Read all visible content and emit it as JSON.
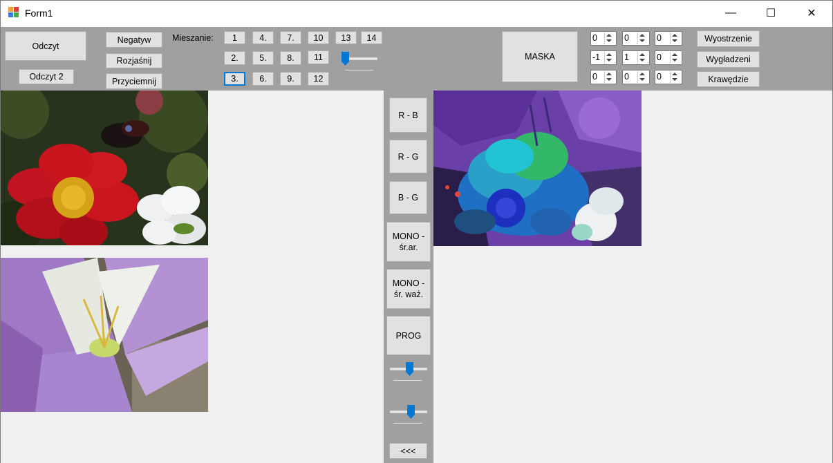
{
  "window": {
    "title": "Form1",
    "minimize": "—",
    "maximize": "☐",
    "close": "✕"
  },
  "toolbar": {
    "read_label": "Odczyt",
    "read2_label": "Odczyt 2",
    "negative_label": "Negatyw",
    "brighten_label": "Rozjaśnij",
    "darken_label": "Przyciemnij",
    "mixing_label": "Mieszanie:",
    "mix_buttons": [
      "1",
      "4.",
      "7.",
      "10",
      "13",
      "14",
      "2.",
      "5.",
      "8.",
      "11",
      "3.",
      "6.",
      "9.",
      "12"
    ],
    "mask_label": "MASKA",
    "mask_values": [
      "0",
      "0",
      "0",
      "-1",
      "1",
      "0",
      "0",
      "0",
      "0"
    ],
    "sharpen_label": "Wyostrzenie",
    "smooth_label": "Wygładzeni",
    "edges_label": "Krawędzie",
    "mix_slider_level": 0
  },
  "middle": {
    "rb_label": "R - B",
    "rg_label": "R - G",
    "bg_label": "B - G",
    "mono_avg_label": "MONO - śr.ar.",
    "mono_weighted_label": "MONO - śr. waż.",
    "threshold_label": "PROG",
    "back_label": "<<<",
    "slider1_level": 0.5,
    "slider2_level": 0.5
  },
  "colors": {
    "toolbar": "#a0a0a0",
    "button": "#e1e1e1",
    "accent": "#0078d7",
    "background": "#f0f0f0"
  }
}
